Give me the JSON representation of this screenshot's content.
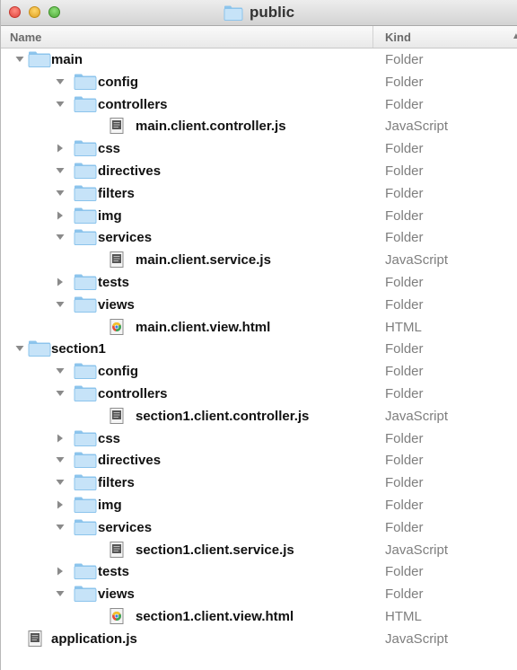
{
  "window": {
    "title": "public"
  },
  "columns": {
    "name": "Name",
    "kind": "Kind",
    "sort_indicator": "▲"
  },
  "rows": [
    {
      "name": "main",
      "kind": "Folder",
      "type": "folder",
      "depth": 0,
      "disclosure": "open"
    },
    {
      "name": "config",
      "kind": "Folder",
      "type": "folder",
      "depth": 1,
      "disclosure": "open"
    },
    {
      "name": "controllers",
      "kind": "Folder",
      "type": "folder",
      "depth": 1,
      "disclosure": "open"
    },
    {
      "name": "main.client.controller.js",
      "kind": "JavaScript",
      "type": "js",
      "depth": 2,
      "disclosure": "none"
    },
    {
      "name": "css",
      "kind": "Folder",
      "type": "folder",
      "depth": 1,
      "disclosure": "closed"
    },
    {
      "name": "directives",
      "kind": "Folder",
      "type": "folder",
      "depth": 1,
      "disclosure": "open"
    },
    {
      "name": "filters",
      "kind": "Folder",
      "type": "folder",
      "depth": 1,
      "disclosure": "open"
    },
    {
      "name": "img",
      "kind": "Folder",
      "type": "folder",
      "depth": 1,
      "disclosure": "closed"
    },
    {
      "name": "services",
      "kind": "Folder",
      "type": "folder",
      "depth": 1,
      "disclosure": "open"
    },
    {
      "name": "main.client.service.js",
      "kind": "JavaScript",
      "type": "js",
      "depth": 2,
      "disclosure": "none"
    },
    {
      "name": "tests",
      "kind": "Folder",
      "type": "folder",
      "depth": 1,
      "disclosure": "closed"
    },
    {
      "name": "views",
      "kind": "Folder",
      "type": "folder",
      "depth": 1,
      "disclosure": "open"
    },
    {
      "name": "main.client.view.html",
      "kind": "HTML",
      "type": "html",
      "depth": 2,
      "disclosure": "none"
    },
    {
      "name": "section1",
      "kind": "Folder",
      "type": "folder",
      "depth": 0,
      "disclosure": "open"
    },
    {
      "name": "config",
      "kind": "Folder",
      "type": "folder",
      "depth": 1,
      "disclosure": "open"
    },
    {
      "name": "controllers",
      "kind": "Folder",
      "type": "folder",
      "depth": 1,
      "disclosure": "open"
    },
    {
      "name": "section1.client.controller.js",
      "kind": "JavaScript",
      "type": "js",
      "depth": 2,
      "disclosure": "none"
    },
    {
      "name": "css",
      "kind": "Folder",
      "type": "folder",
      "depth": 1,
      "disclosure": "closed"
    },
    {
      "name": "directives",
      "kind": "Folder",
      "type": "folder",
      "depth": 1,
      "disclosure": "open"
    },
    {
      "name": "filters",
      "kind": "Folder",
      "type": "folder",
      "depth": 1,
      "disclosure": "open"
    },
    {
      "name": "img",
      "kind": "Folder",
      "type": "folder",
      "depth": 1,
      "disclosure": "closed"
    },
    {
      "name": "services",
      "kind": "Folder",
      "type": "folder",
      "depth": 1,
      "disclosure": "open"
    },
    {
      "name": "section1.client.service.js",
      "kind": "JavaScript",
      "type": "js",
      "depth": 2,
      "disclosure": "none"
    },
    {
      "name": "tests",
      "kind": "Folder",
      "type": "folder",
      "depth": 1,
      "disclosure": "closed"
    },
    {
      "name": "views",
      "kind": "Folder",
      "type": "folder",
      "depth": 1,
      "disclosure": "open"
    },
    {
      "name": "section1.client.view.html",
      "kind": "HTML",
      "type": "html",
      "depth": 2,
      "disclosure": "none"
    },
    {
      "name": "application.js",
      "kind": "JavaScript",
      "type": "js",
      "depth": 0,
      "disclosure": "none"
    }
  ],
  "colors": {
    "folder_light": "#c6e3f8",
    "folder_dark": "#8cc4ec",
    "kind_text": "#7e7e7e",
    "disclosure": "#8a8a8a"
  }
}
